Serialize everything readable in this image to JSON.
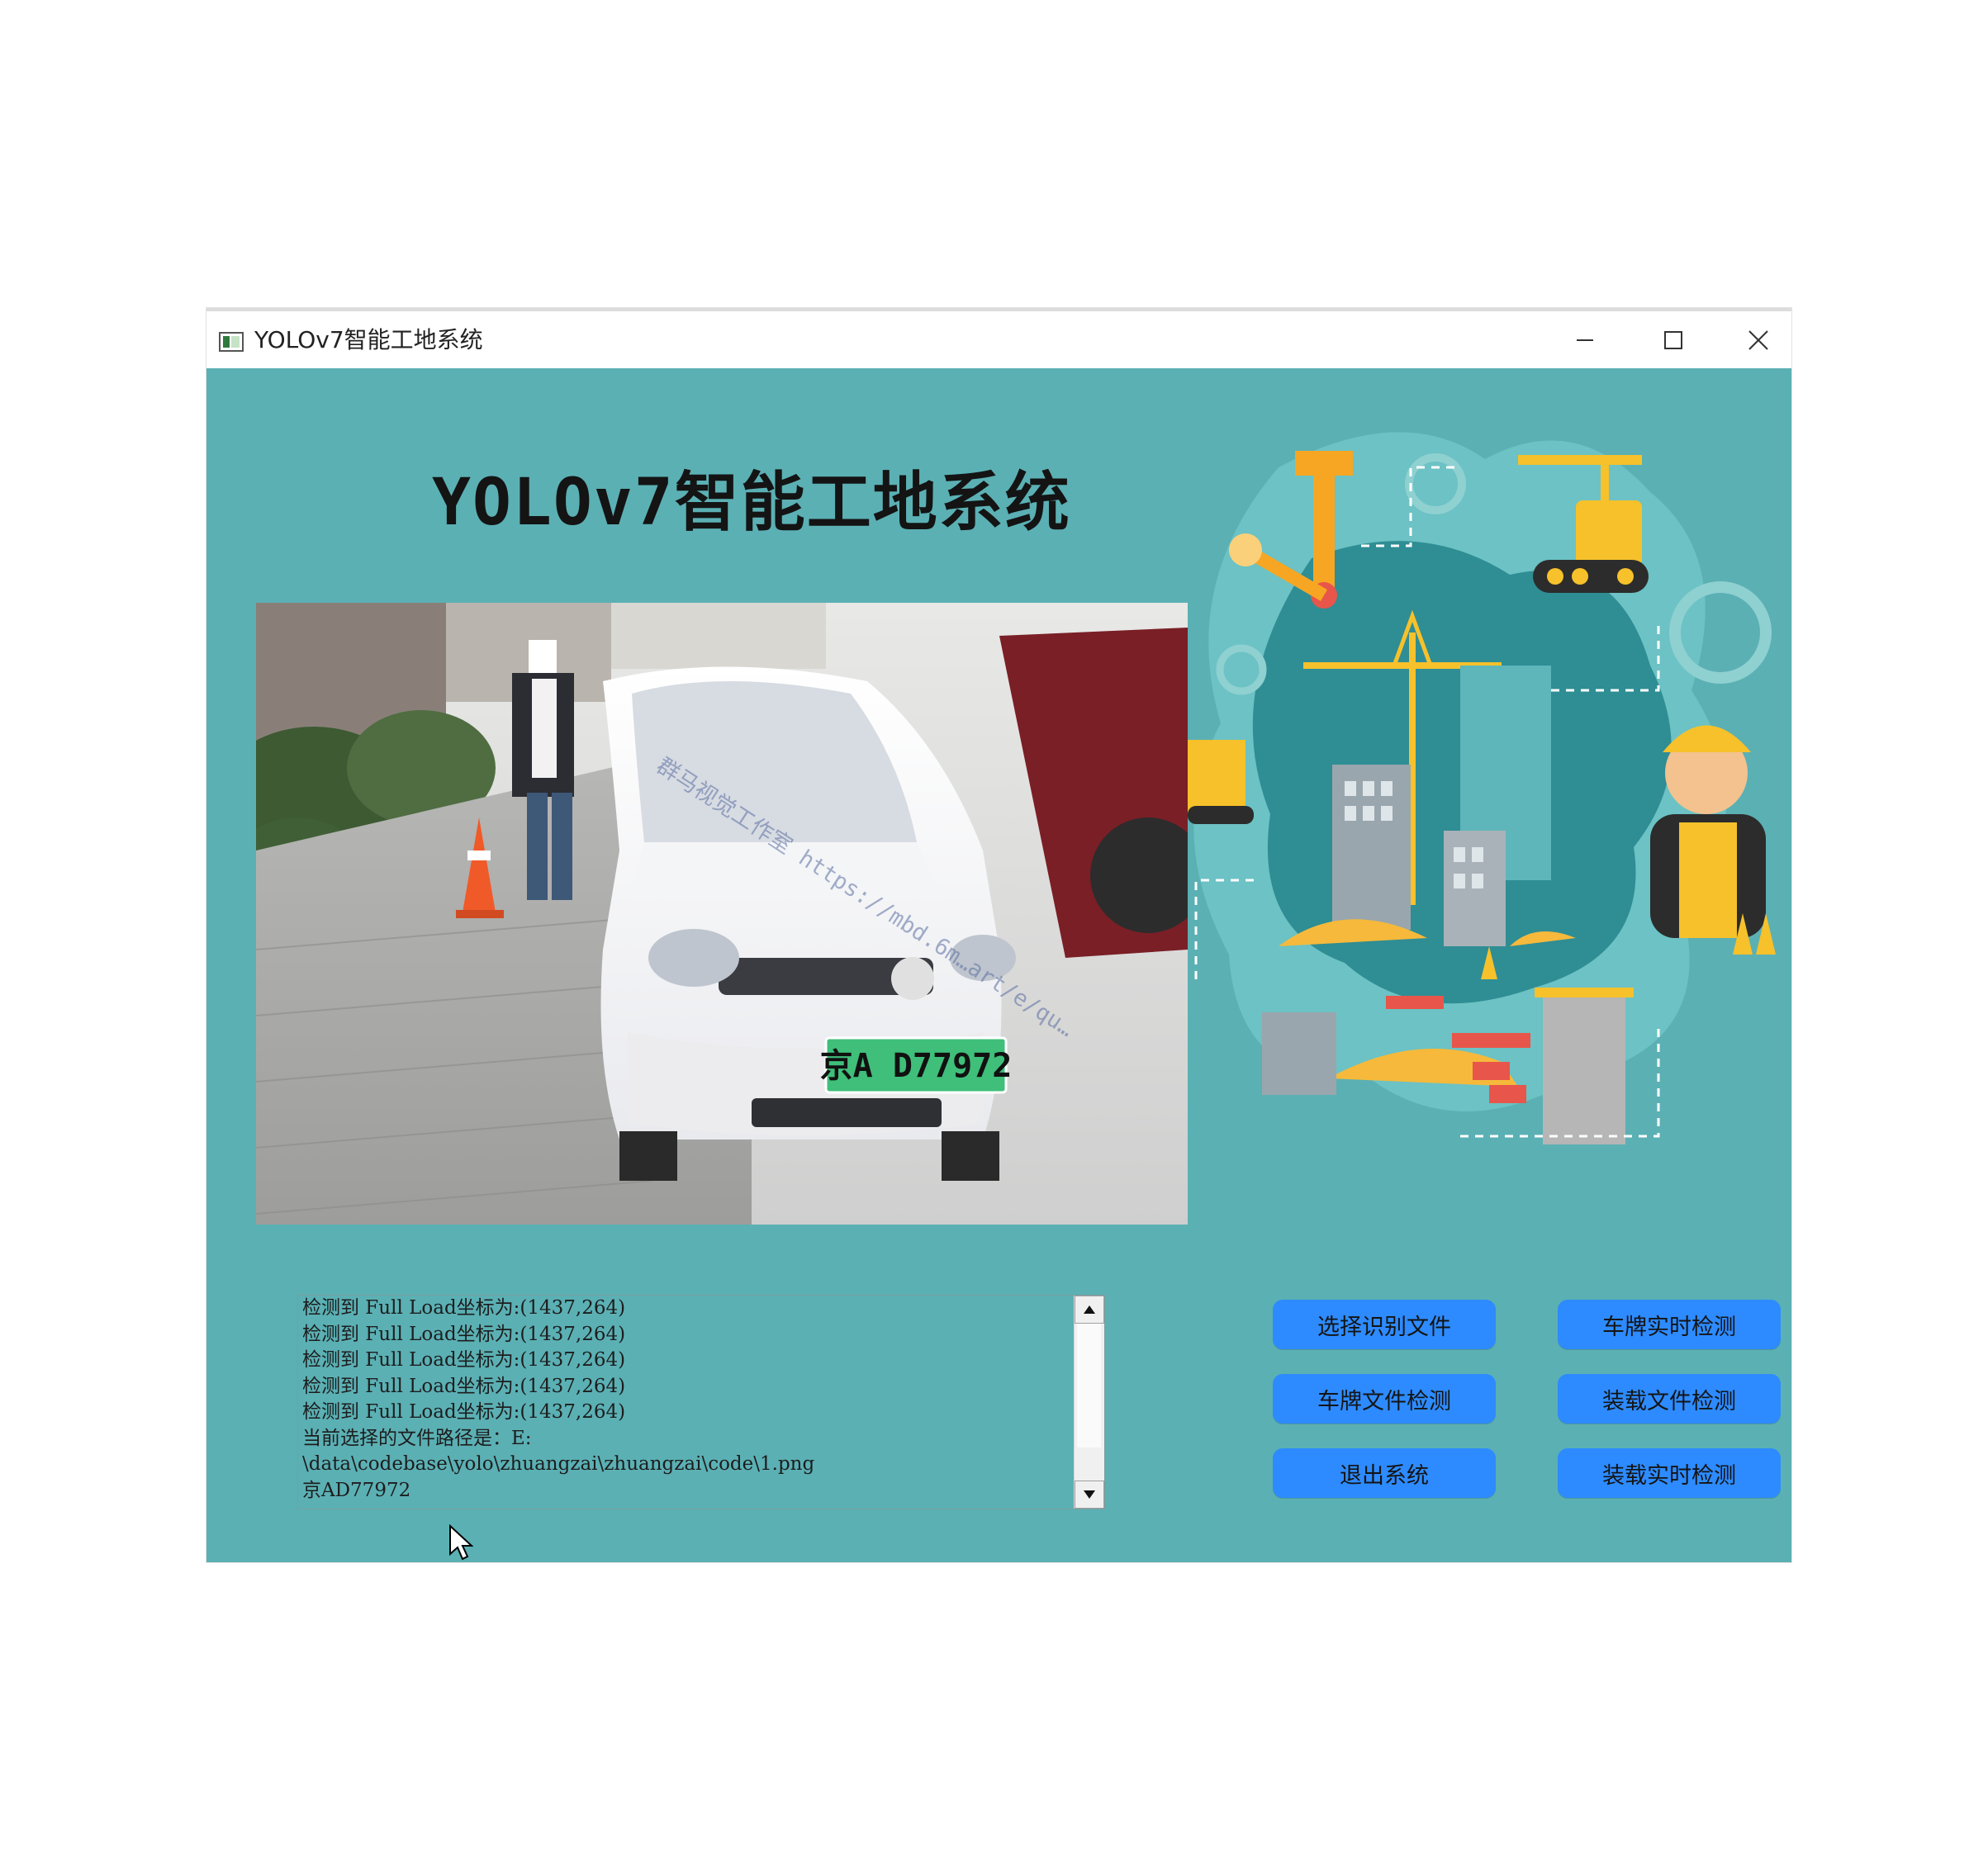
{
  "window": {
    "title": "YOLOv7智能工地系统",
    "controls": [
      "minimize",
      "maximize",
      "close"
    ]
  },
  "app": {
    "heading": "YOLOv7智能工地系统"
  },
  "detection_image": {
    "plate_text": "京A D77972",
    "watermark": "群马视觉工作室 https://mbd.6m…art/e/qu…"
  },
  "log": {
    "lines": [
      "检测到 Full Load坐标为:(1437,264)",
      "检测到 Full Load坐标为:(1437,264)",
      "检测到 Full Load坐标为:(1437,264)",
      "检测到 Full Load坐标为:(1437,264)",
      "检测到 Full Load坐标为:(1437,264)",
      "当前选择的文件路径是：E:",
      "\\data\\codebase\\yolo\\zhuangzai\\zhuangzai\\code\\1.png",
      "京AD77972"
    ]
  },
  "buttons": {
    "select_file": "选择识别文件",
    "plate_realtime": "车牌实时检测",
    "plate_file": "车牌文件检测",
    "load_file": "装载文件检测",
    "exit": "退出系统",
    "load_realtime": "装载实时检测"
  },
  "colors": {
    "background": "#5bb0b4",
    "button": "#2d8bff",
    "plate_green": "#3fbf7a"
  },
  "icons": [
    "app-window-icon",
    "minimize-icon",
    "maximize-icon",
    "close-icon",
    "scroll-up-icon",
    "scroll-down-icon",
    "mouse-cursor-icon"
  ]
}
